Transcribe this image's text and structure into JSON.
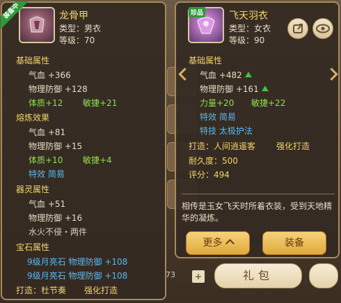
{
  "left_item": {
    "badge": "装备中",
    "name": "龙骨甲",
    "type": "类型：男衣",
    "level": "等级：70",
    "sections": {
      "base_title": "基础属性",
      "base": [
        {
          "label": "气血",
          "value": "+366"
        },
        {
          "label": "物理防御",
          "value": "+128"
        }
      ],
      "base_extra": {
        "a": "体质+12",
        "b": "敏捷+21"
      },
      "smelt_title": "熔炼效果",
      "smelt": [
        {
          "label": "气血",
          "value": "+81"
        },
        {
          "label": "物理防御",
          "value": "+15"
        }
      ],
      "smelt_extra": {
        "a": "体质+10",
        "b": "敏捷+4"
      },
      "smelt_effect": "特效  简易",
      "spirit_title": "器灵属性",
      "spirit": [
        {
          "label": "气血",
          "value": "+51"
        },
        {
          "label": "物理防御",
          "value": "+16"
        }
      ],
      "spirit_set": "水火不侵・两件",
      "gem_title": "宝石属性",
      "gems": [
        {
          "gem": "9级月亮石",
          "label": "物理防御",
          "value": "+108"
        },
        {
          "gem": "9级月亮石",
          "label": "物理防御",
          "value": "+108"
        }
      ],
      "forge": "打造：杜节奏",
      "forge_type": "强化打造"
    }
  },
  "right_item": {
    "badge": "珍品",
    "name": "飞天羽衣",
    "type": "类型：女衣",
    "level": "等级：90",
    "base_title": "基础属性",
    "base": [
      {
        "label": "气血",
        "value": "+482"
      },
      {
        "label": "物理防御",
        "value": "+161"
      }
    ],
    "base_extra": {
      "a": "力量+20",
      "b": "敏捷+22"
    },
    "effect": "特效  简易",
    "skill": "特技  太极护法",
    "forge": "打造：人间逍遥客",
    "forge_type": "强化打造",
    "durability": "耐久度：500",
    "score": "评分：494",
    "description": "相传是玉女飞天时所着衣装，受到天地精华的凝炼。",
    "more_label": "更多",
    "equip_label": "装备"
  },
  "background": {
    "count_text": "73",
    "gift_label": "礼包"
  },
  "icons": [
    "share-icon",
    "eye-icon",
    "arrow-up-icon",
    "chevron-left-icon",
    "chevron-right-icon",
    "chevron-up-icon",
    "plus-icon"
  ]
}
